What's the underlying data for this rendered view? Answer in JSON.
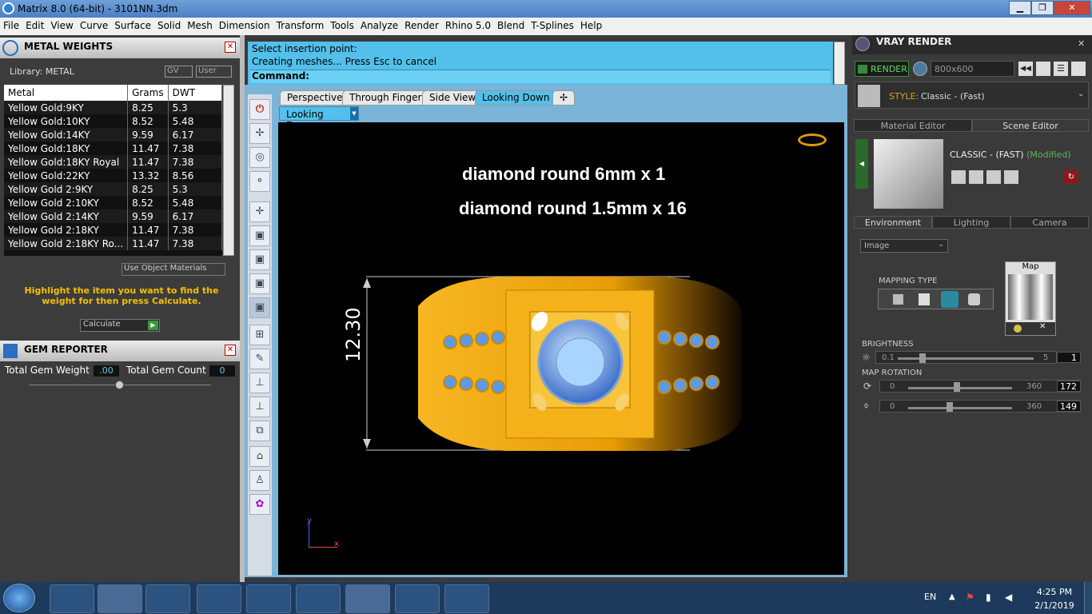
{
  "window": {
    "title": "Matrix 8.0 (64-bit) - 3101NN.3dm",
    "min": "▁",
    "max": "❐",
    "close": "✕"
  },
  "menu": [
    "File",
    "Edit",
    "View",
    "Curve",
    "Surface",
    "Solid",
    "Mesh",
    "Dimension",
    "Transform",
    "Tools",
    "Analyze",
    "Render",
    "Rhino 5.0",
    "Blend",
    "T-Splines",
    "Help"
  ],
  "metal_weights": {
    "title": "METAL WEIGHTS",
    "library": "Library: METAL",
    "gv": "GV",
    "user": "User",
    "columns": [
      "Metal",
      "Grams",
      "DWT"
    ],
    "rows": [
      [
        "Yellow Gold:9KY",
        "8.25",
        "5.3"
      ],
      [
        "Yellow Gold:10KY",
        "8.52",
        "5.48"
      ],
      [
        "Yellow Gold:14KY",
        "9.59",
        "6.17"
      ],
      [
        "Yellow Gold:18KY",
        "11.47",
        "7.38"
      ],
      [
        "Yellow Gold:18KY Royal",
        "11.47",
        "7.38"
      ],
      [
        "Yellow Gold:22KY",
        "13.32",
        "8.56"
      ],
      [
        "Yellow Gold 2:9KY",
        "8.25",
        "5.3"
      ],
      [
        "Yellow Gold 2:10KY",
        "8.52",
        "5.48"
      ],
      [
        "Yellow Gold 2:14KY",
        "9.59",
        "6.17"
      ],
      [
        "Yellow Gold 2:18KY",
        "11.47",
        "7.38"
      ],
      [
        "Yellow Gold 2:18KY Ro...",
        "11.47",
        "7.38"
      ]
    ],
    "use_object_materials": "Use Object Materials",
    "hint": "Highlight the item you want to find the weight for then press Calculate.",
    "calculate": "Calculate"
  },
  "gem_reporter": {
    "title": "GEM REPORTER",
    "total_weight_label": "Total Gem Weight",
    "total_weight": ".00",
    "total_count_label": "Total Gem Count",
    "total_count": "0"
  },
  "command": {
    "line1": "Select insertion point:",
    "line2": "Creating meshes... Press Esc to cancel",
    "prompt": "Command:"
  },
  "tabs": [
    "Perspective",
    "Through Finger",
    "Side View",
    "Looking Down"
  ],
  "active_view": "Looking Down",
  "viewport": {
    "text1": "diamond  round 6mm x 1",
    "text2": "diamond  round 1.5mm x 16",
    "dimension": "12.30",
    "axis_y": "y",
    "axis_x": "x"
  },
  "vray": {
    "title": "VRAY RENDER",
    "render": "RENDER",
    "resolution": "800x600",
    "style_label": "STYLE:",
    "style_value": "Classic - (Fast)",
    "tab_material": "Material Editor",
    "tab_scene": "Scene Editor",
    "scene_name": "CLASSIC - (FAST)",
    "scene_modified": "(Modified)",
    "tab_env": "Environment",
    "tab_light": "Lighting",
    "tab_cam": "Camera",
    "env_type": "Image",
    "mapping_type": "MAPPING TYPE",
    "map_label": "Map",
    "brightness": "BRIGHTNESS",
    "b_min": "0.1",
    "b_max": "5",
    "b_val": "1",
    "map_rotation": "MAP ROTATION",
    "rot1_min": "0",
    "rot1_max": "360",
    "rot1_val": "172",
    "rot2_min": "0",
    "rot2_max": "360",
    "rot2_val": "149"
  },
  "tray": {
    "lang": "EN",
    "time": "4:25 PM",
    "date": "2/1/2019"
  }
}
